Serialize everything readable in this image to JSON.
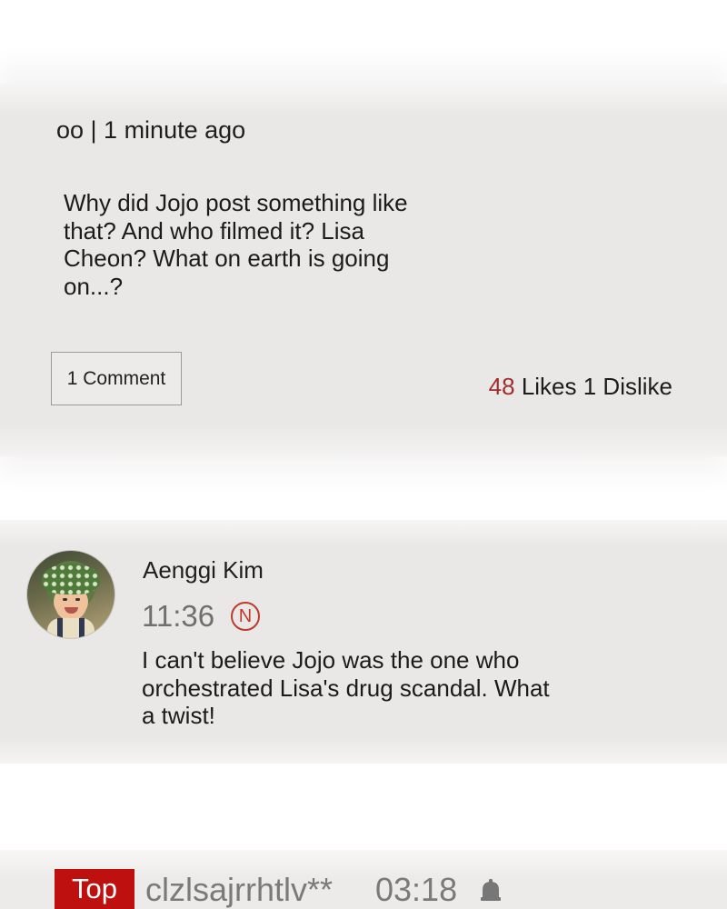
{
  "post": {
    "meta": "oo | 1 minute ago",
    "body": "Why did Jojo post something like that? And who filmed it? Lisa Cheon? What on earth is going on...?",
    "comment_button_label": "1 Comment",
    "likes_count": "48",
    "likes_label": "Likes",
    "dislikes_text": "1 Dislike"
  },
  "comment": {
    "avatar_icon": "child-photo-avatar",
    "author": "Aenggi Kim",
    "time": "11:36",
    "new_badge": "N",
    "body": "I can't believe Jojo was the one who orchestrated Lisa's drug scandal. What a twist!"
  },
  "bottom_bar": {
    "top_button_label": "Top",
    "username": "clzlsajrrhtlv**",
    "time": "03:18",
    "icon": "bell-icon"
  },
  "colors": {
    "accent_red": "#bf1010",
    "likes_red": "#a12c2c",
    "band_gray": "#e9e8e7"
  }
}
